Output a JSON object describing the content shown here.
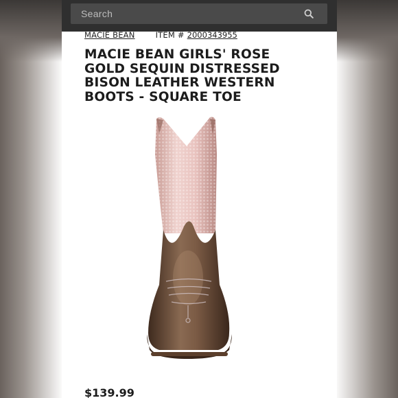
{
  "search": {
    "placeholder": "Search",
    "icon": "search-icon"
  },
  "product": {
    "brand": "MACIE BEAN",
    "item_label": "ITEM #",
    "item_number": "2000343955",
    "title": "MACIE BEAN GIRLS' ROSE GOLD SEQUIN DISTRESSED BISON LEATHER WESTERN BOOTS - SQUARE TOE",
    "price": "$139.99"
  },
  "colors": {
    "header": "#2f2f2f",
    "sequin": "#e6bfbb",
    "leather": "#5a3e2b"
  }
}
